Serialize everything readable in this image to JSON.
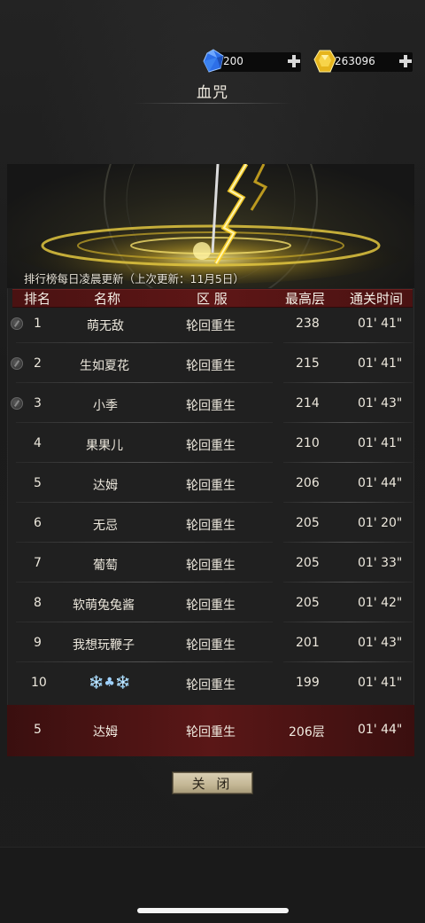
{
  "currency": {
    "diamond": {
      "value": "200",
      "icon": "blue-gem-icon"
    },
    "gold": {
      "value": "263096",
      "icon": "gold-gem-icon"
    }
  },
  "title": "血咒",
  "update_note": "排行榜每日凌晨更新（上次更新：11月5日）",
  "table": {
    "headers": {
      "rank": "排名",
      "name": "名称",
      "server": "区 服",
      "highest": "最高层",
      "time": "通关时间"
    },
    "rows": [
      {
        "rank": "1",
        "name": "萌无敌",
        "server": "轮回重生",
        "highest": "238",
        "time": "01' 41\""
      },
      {
        "rank": "2",
        "name": "生如夏花",
        "server": "轮回重生",
        "highest": "215",
        "time": "01' 41\""
      },
      {
        "rank": "3",
        "name": "小季",
        "server": "轮回重生",
        "highest": "214",
        "time": "01' 43\""
      },
      {
        "rank": "4",
        "name": "果果儿",
        "server": "轮回重生",
        "highest": "210",
        "time": "01' 41\""
      },
      {
        "rank": "5",
        "name": "达姆",
        "server": "轮回重生",
        "highest": "206",
        "time": "01' 44\""
      },
      {
        "rank": "6",
        "name": "无忌",
        "server": "轮回重生",
        "highest": "205",
        "time": "01' 20\""
      },
      {
        "rank": "7",
        "name": "葡萄",
        "server": "轮回重生",
        "highest": "205",
        "time": "01' 33\""
      },
      {
        "rank": "8",
        "name": "软萌兔兔酱",
        "server": "轮回重生",
        "highest": "205",
        "time": "01' 42\""
      },
      {
        "rank": "9",
        "name": "我想玩鞭子",
        "server": "轮回重生",
        "highest": "201",
        "time": "01' 43\""
      },
      {
        "rank": "10",
        "name": "❄️♣❄️",
        "server": "轮回重生",
        "highest": "199",
        "time": "01' 41\""
      }
    ],
    "self": {
      "rank": "5",
      "name": "达姆",
      "server": "轮回重生",
      "highest": "206层",
      "time": "01' 44\""
    }
  },
  "close_button": "关 闭"
}
